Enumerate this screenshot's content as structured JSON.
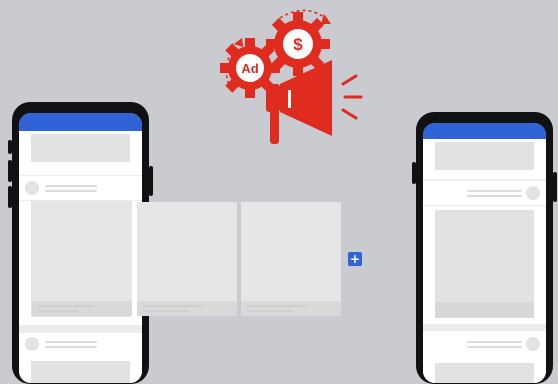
{
  "illustration": {
    "gear_left_text": "Ad",
    "gear_right_text": "$",
    "accent_color": "#e02b1f",
    "brand_blue": "#2f63d6"
  },
  "carousel": {
    "add_button_label": "+"
  }
}
